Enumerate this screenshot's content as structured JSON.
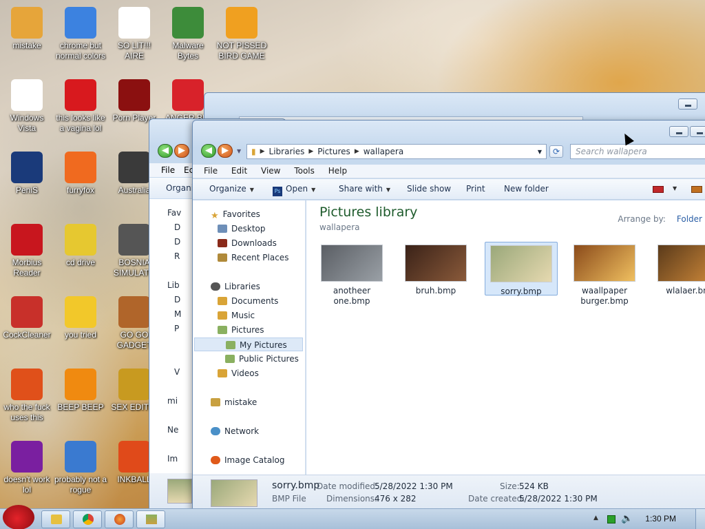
{
  "desktop": {
    "icons": [
      {
        "label": "mistake",
        "glyph": "folder-icon",
        "color": "#e6a53a"
      },
      {
        "label": "chrome but normal colors",
        "glyph": "chrome-icon",
        "color": "#3c82e0"
      },
      {
        "label": "SO LIT!!! AIRE",
        "glyph": "cards-icon",
        "color": "#ffffff"
      },
      {
        "label": "Malware Bytes",
        "glyph": "shield-icon",
        "color": "#3d8c3a"
      },
      {
        "label": "NOT PISSED BIRD GAME",
        "glyph": "pig-icon",
        "color": "#f0a020"
      },
      {
        "label": "Windows Vista",
        "glyph": "egg-icon",
        "color": "#ffffff"
      },
      {
        "label": "this looks like a vagina lol",
        "glyph": "opera-icon",
        "color": "#d8191e"
      },
      {
        "label": "Porn Player",
        "glyph": "flash-icon",
        "color": "#8b1010"
      },
      {
        "label": "ANGER BIR",
        "glyph": "angry-bird-icon",
        "color": "#d8222a"
      },
      {
        "label": "PeniS",
        "glyph": "photoshop-icon",
        "color": "#1a3a7a"
      },
      {
        "label": "furryfox",
        "glyph": "firefox-icon",
        "color": "#f06a1f"
      },
      {
        "label": "Australia",
        "glyph": "spider-icon",
        "color": "#3a3a3a"
      },
      {
        "label": "Morbius Reader",
        "glyph": "acrobat-icon",
        "color": "#c8161e"
      },
      {
        "label": "cd drive",
        "glyph": "cd-icon",
        "color": "#e6c830"
      },
      {
        "label": "BOSNIA SIMULATO",
        "glyph": "mine-icon",
        "color": "#555555"
      },
      {
        "label": "CockCleaner",
        "glyph": "ccleaner-icon",
        "color": "#c8302a"
      },
      {
        "label": "you tried",
        "glyph": "star-icon",
        "color": "#f2c82a"
      },
      {
        "label": "GO GO GADGET",
        "glyph": "briefcase-icon",
        "color": "#b0652a"
      },
      {
        "label": "who the fuck uses this",
        "glyph": "lightning-icon",
        "color": "#e0501a"
      },
      {
        "label": "BEEP BEEP",
        "glyph": "vlc-icon",
        "color": "#f08a10"
      },
      {
        "label": "SEX EDITIO",
        "glyph": "hxd-icon",
        "color": "#c89a20"
      },
      {
        "label": "doesn't work lol",
        "glyph": "yahoo-icon",
        "color": "#7a1fa0"
      },
      {
        "label": "probably not a rogue",
        "glyph": "gears-icon",
        "color": "#3a7ad0"
      },
      {
        "label": "INKBALL",
        "glyph": "ball-icon",
        "color": "#e04a1a"
      }
    ]
  },
  "back_window": {
    "menu": [
      "File",
      "Ec"
    ],
    "cmd": "Organi",
    "nav_items": [
      "Fav",
      "D",
      "D",
      "R",
      "Lib",
      "D",
      "M",
      "P",
      "",
      "",
      "V",
      "mi",
      "Ne",
      "Im"
    ]
  },
  "explorer": {
    "address": {
      "crumbs": [
        "Libraries",
        "Pictures",
        "wallapera"
      ]
    },
    "search_placeholder": "Search wallapera",
    "menu": [
      "File",
      "Edit",
      "View",
      "Tools",
      "Help"
    ],
    "commands": {
      "organize": "Organize",
      "open": "Open",
      "share_with": "Share with",
      "slide_show": "Slide show",
      "print": "Print",
      "new_folder": "New folder"
    },
    "nav": {
      "favorites": "Favorites",
      "desktop": "Desktop",
      "downloads": "Downloads",
      "recent_places": "Recent Places",
      "libraries": "Libraries",
      "documents": "Documents",
      "music": "Music",
      "pictures": "Pictures",
      "my_pictures": "My Pictures",
      "public_pictures": "Public Pictures",
      "videos": "Videos",
      "mistake": "mistake",
      "network": "Network",
      "image_catalog": "Image Catalog"
    },
    "library": {
      "title": "Pictures library",
      "subtitle": "wallapera",
      "arrange_label": "Arrange by:",
      "arrange_value": "Folder"
    },
    "files": [
      {
        "name": "anotheer one.bmp",
        "colors": [
          "#5a5e64",
          "#9aa0a6"
        ]
      },
      {
        "name": "bruh.bmp",
        "colors": [
          "#3a2218",
          "#8a5a3a"
        ]
      },
      {
        "name": "sorry.bmp",
        "colors": [
          "#9aa87a",
          "#e6d9b0"
        ]
      },
      {
        "name": "waallpaper burger.bmp",
        "colors": [
          "#8a4a1a",
          "#f0c060"
        ]
      },
      {
        "name": "wlalaer.bm",
        "colors": [
          "#5a3a1a",
          "#d08a3a"
        ]
      }
    ],
    "details": {
      "name": "sorry.bmp",
      "type": "BMP File",
      "date_modified_label": "Date modified:",
      "date_modified": "5/28/2022 1:30 PM",
      "dimensions_label": "Dimensions:",
      "dimensions": "476 x 282",
      "size_label": "Size:",
      "size": "524 KB",
      "date_created_label": "Date created:",
      "date_created": "5/28/2022 1:30 PM"
    }
  },
  "taskbar": {
    "clock": "1:30 PM"
  }
}
